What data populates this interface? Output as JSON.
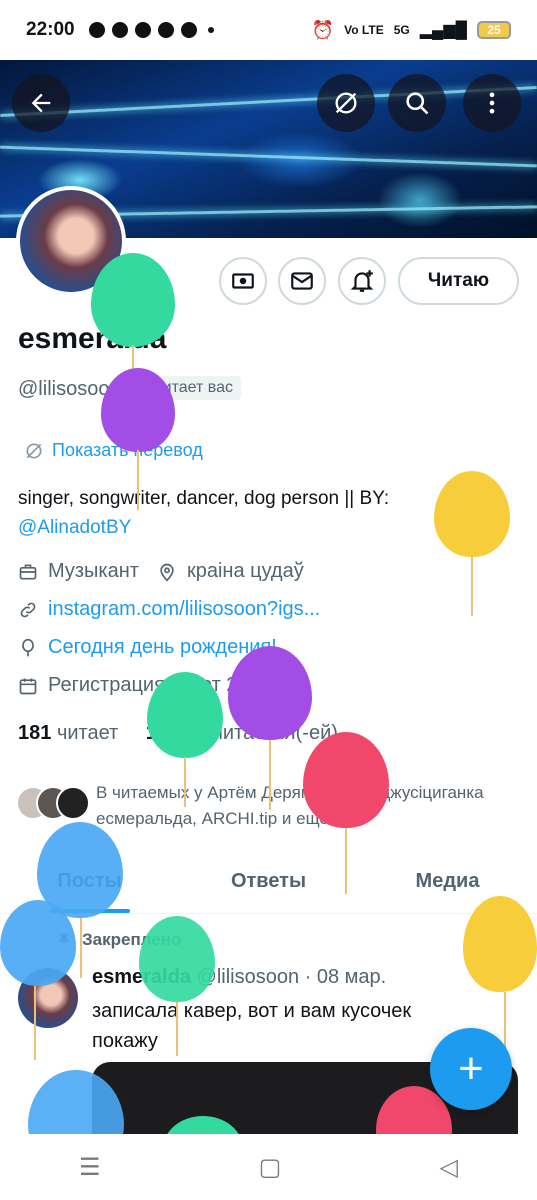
{
  "status_bar": {
    "time": "22:00",
    "battery": "25",
    "network": "Vo LTE",
    "signal": "5G"
  },
  "header": {
    "back_icon": "arrow-left-icon",
    "translate_icon": "translate-off-icon",
    "search_icon": "search-icon",
    "more_icon": "more-vertical-icon"
  },
  "profile": {
    "name": "esmeralda",
    "handle": "@lilisosoon",
    "follows_you": "Читает вас",
    "translate": "Показать перевод",
    "bio_text": "singer, songwriter, dancer, dog person || BY:",
    "bio_link": "@AlinadotBY",
    "category": "Музыкант",
    "location": "краiна цудаў",
    "website": "instagram.com/lilisosoon?igs...",
    "birthday": "Сегодня день рождения!",
    "joined": "Регистрация: март 2014 г.",
    "following_count": "181",
    "following_label": "читает",
    "followers_count": "16 333",
    "followers_label": "читателя(-ей)",
    "mutuals": "В читаемых у Артём Дерягин v. 2.0, джусiциганка есмеральда, ARCHI.tip и еще: 14"
  },
  "actions": {
    "follow_label": "Читаю"
  },
  "tabs": [
    {
      "label": "Посты"
    },
    {
      "label": "Ответы"
    },
    {
      "label": "Медиа"
    }
  ],
  "pinned_post": {
    "pinned_label": "Закреплено",
    "author": "esmeralda",
    "handle_date": "@lilisosoon · 08 мар.",
    "text": "записала кавер, вот и вам кусочек покажу"
  },
  "fab": {
    "label": "+"
  },
  "nav": {
    "recents": "☰",
    "home": "▢",
    "back": "◁"
  },
  "colors": {
    "accent": "#1d9bf0",
    "balloon_green": "#34d9a0",
    "balloon_purple": "#a24ee6",
    "balloon_yellow": "#f7cd3b",
    "balloon_red": "#f0476a",
    "balloon_blue": "#4aa8f5"
  }
}
